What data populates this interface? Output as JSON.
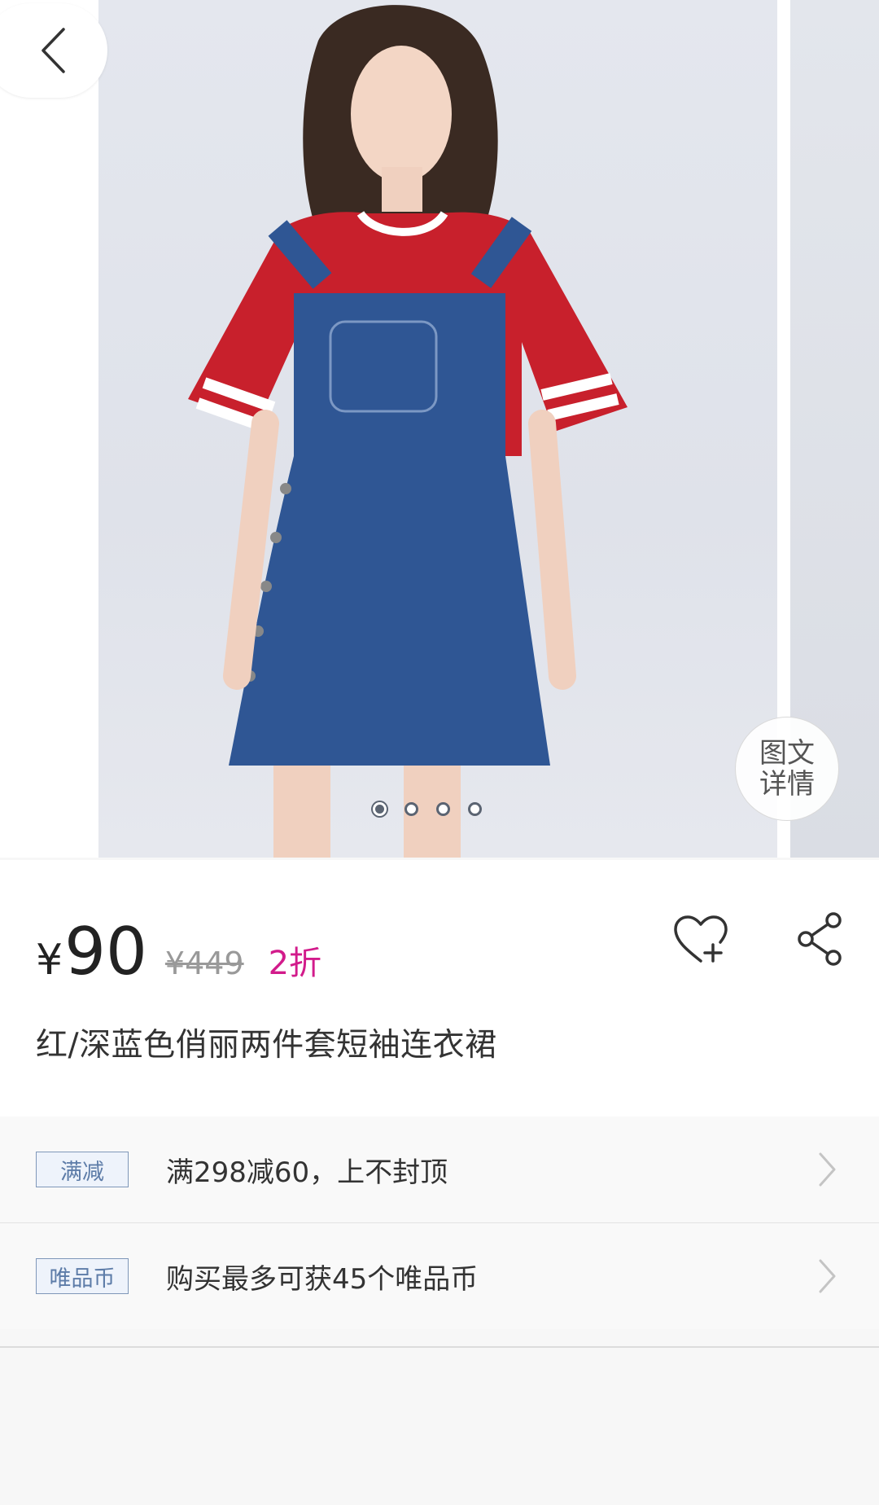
{
  "gallery": {
    "detail_button_line1": "图文",
    "detail_button_line2": "详情",
    "dots_total": 4,
    "active_dot_index": 0
  },
  "product": {
    "currency": "¥",
    "price": "90",
    "original_price": "¥449",
    "discount": "2折",
    "title": "红/深蓝色俏丽两件套短袖连衣裙"
  },
  "promos": [
    {
      "tag": "满减",
      "text": "满298减60，上不封顶"
    },
    {
      "tag": "唯品币",
      "text": "购买最多可获45个唯品币"
    }
  ],
  "colors": {
    "discount": "#d21b8b",
    "tag_border": "#7f97b9",
    "tag_text": "#5d7ca8"
  }
}
